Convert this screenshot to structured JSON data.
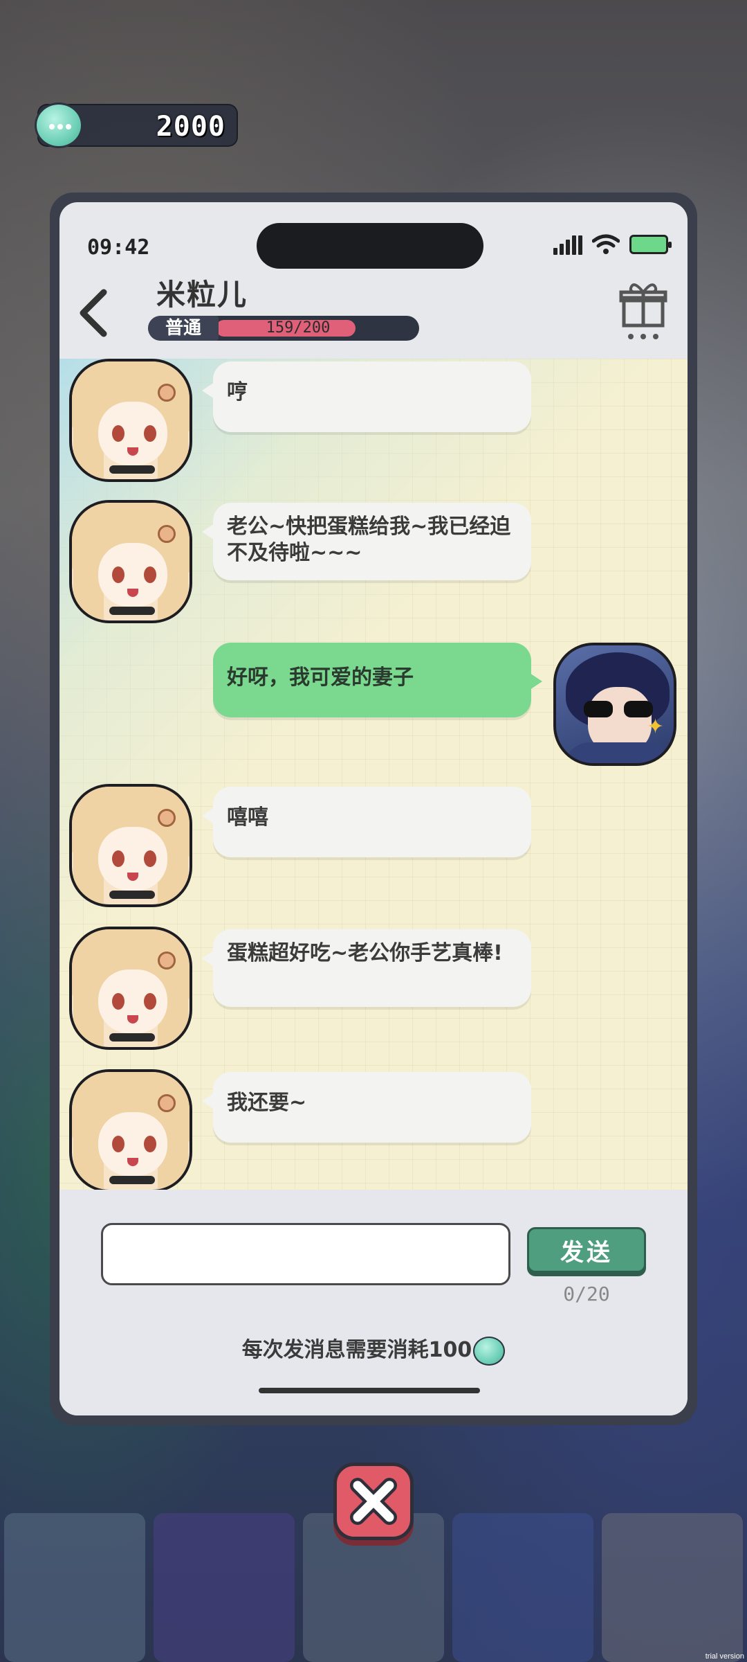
{
  "currency": {
    "amount": "2000",
    "icon": "chat-coin-icon"
  },
  "status_bar": {
    "time": "09:42"
  },
  "header": {
    "contact_name": "米粒儿",
    "level_label": "普通",
    "affection_text": "159/200",
    "affection_fraction": 0.795
  },
  "messages": [
    {
      "side": "left",
      "text": "哼"
    },
    {
      "side": "left",
      "text": "老公~快把蛋糕给我~我已经迫不及待啦~~~"
    },
    {
      "side": "right",
      "text": "好呀，我可爱的妻子"
    },
    {
      "side": "left",
      "text": "嘻嘻"
    },
    {
      "side": "left",
      "text": "蛋糕超好吃~老公你手艺真棒!"
    },
    {
      "side": "left",
      "text": "我还要~"
    }
  ],
  "composer": {
    "input_value": "",
    "send_label": "发送",
    "char_count": "0/20",
    "cost_note": "每次发消息需要消耗100"
  },
  "watermark": "trial version",
  "colors": {
    "accent_green": "#7ad98f",
    "send_button": "#4e9e7f",
    "close_button": "#e05a68",
    "affection_bar": "#e0607a"
  }
}
